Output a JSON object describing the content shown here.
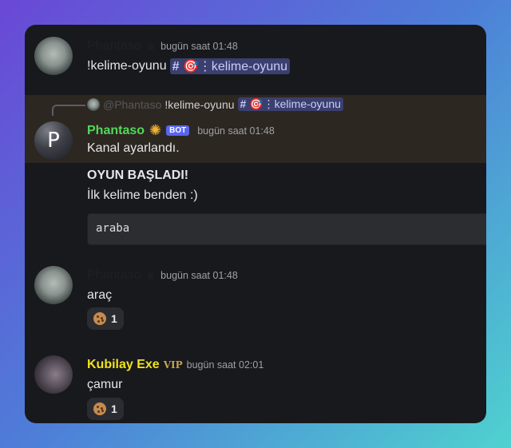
{
  "messages": [
    {
      "username": "Phantaso",
      "timestamp": "bugün saat 01:48",
      "text": "!kelime-oyunu",
      "channel_mention": "🎯⋮kelime-oyunu"
    },
    {
      "reply": {
        "username": "@Phantaso",
        "text": "!kelime-oyunu",
        "channel_mention": "🎯⋮kelime-oyunu"
      },
      "username": "Phantaso",
      "bot_badge": "BOT",
      "timestamp": "bugün saat 01:48",
      "avatar_letter": "P",
      "text": "Kanal ayarlandı."
    },
    {
      "bold_text": "OYUN BAŞLADI!",
      "text": "İlk kelime benden :)",
      "code_block": "araba"
    },
    {
      "username": "Phantaso",
      "timestamp": "bugün saat 01:48",
      "text": "araç",
      "reaction": {
        "emoji": "cookie-icon",
        "count": "1"
      }
    },
    {
      "username": "Kubilay Exe",
      "vip_badge": "VIP",
      "timestamp": "bugün saat 02:01",
      "text": "çamur",
      "reaction": {
        "emoji": "cookie-icon",
        "count": "1"
      }
    }
  ]
}
